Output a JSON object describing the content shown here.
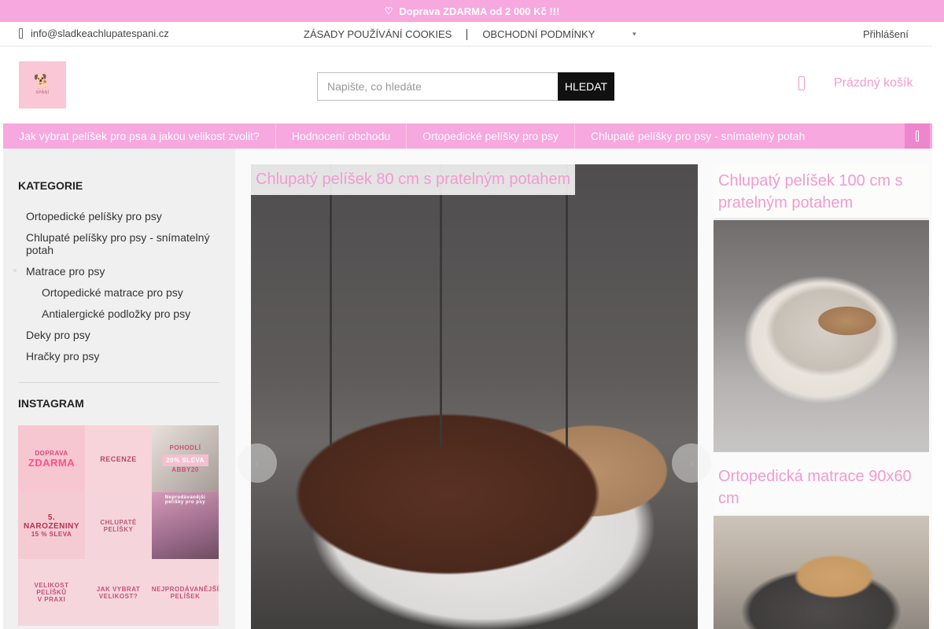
{
  "promo": {
    "icon": "heart-icon",
    "text": "Doprava ZDARMA od 2 000 Kč !!!"
  },
  "top_bar": {
    "email": "info@sladkeachlupatespani.cz",
    "links": [
      "ZÁSADY POUŽÍVÁNÍ COOKIES",
      "OBCHODNÍ PODMÍNKY"
    ],
    "more_icon": "chevron-down-icon",
    "login": "Přihlášení"
  },
  "header": {
    "logo_text": "SPANÍ",
    "search": {
      "placeholder": "Napište, co hledáte",
      "button": "HLEDAT"
    },
    "cart": {
      "label": "Prázdný košík",
      "icon": "cart-icon"
    }
  },
  "nav": {
    "items": [
      "Jak vybrat pelíšek pro psa a jakou velikost zvolit?",
      "Hodnocení obchodu",
      "Ortopedické pelíšky pro psy",
      "Chlupaté pelíšky pro psy - snímatelný potah"
    ],
    "menu_icon": "hamburger-icon"
  },
  "sidebar": {
    "categories_title": "KATEGORIE",
    "categories": [
      {
        "label": "Ortopedické pelíšky pro psy",
        "level": 0
      },
      {
        "label": "Chlupaté pelíšky pro psy - snímatelný potah",
        "level": 0
      },
      {
        "label": "Matrace pro psy",
        "level": 0
      },
      {
        "label": "Ortopedické matrace pro psy",
        "level": 1
      },
      {
        "label": "Antialergické podložky pro psy",
        "level": 1
      },
      {
        "label": "Deky pro psy",
        "level": 0
      },
      {
        "label": "Hračky pro psy",
        "level": 0
      }
    ],
    "instagram_title": "INSTAGRAM",
    "instagram": {
      "t1": [
        "DOPRAVA",
        "ZDARMA"
      ],
      "t2": "RECENZE",
      "t3": [
        "POHODLÍ",
        "20% SLEVA",
        "ABBY20"
      ],
      "t4": [
        "5. NAROZENINY",
        "15 % SLEVA"
      ],
      "t5": "CHLUPATÉ PELÍŠKY",
      "t6": "Neprodávanější pelíšky pro psy",
      "t7": [
        "VELIKOST PELÍŠKŮ",
        "V PRAXI"
      ],
      "t8": [
        "JAK VYBRAT",
        "VELIKOST?"
      ],
      "t9": [
        "NEJPRODÁVANĚJŠÍ",
        "PELÍŠEK"
      ]
    }
  },
  "products": {
    "main": {
      "title": "Chlupatý pelíšek 80 cm s pratelným potahem"
    },
    "side": [
      {
        "title": "Chlupatý pelíšek 100 cm s pratelným potahem"
      },
      {
        "title": "Ortopedická matrace 90x60 cm"
      }
    ]
  },
  "slider": {
    "prev_icon": "chevron-left-icon",
    "next_icon": "chevron-right-icon"
  },
  "colors": {
    "accent_pink": "#f7a8df",
    "title_pink": "#f19bd0",
    "button_black": "#111111"
  }
}
